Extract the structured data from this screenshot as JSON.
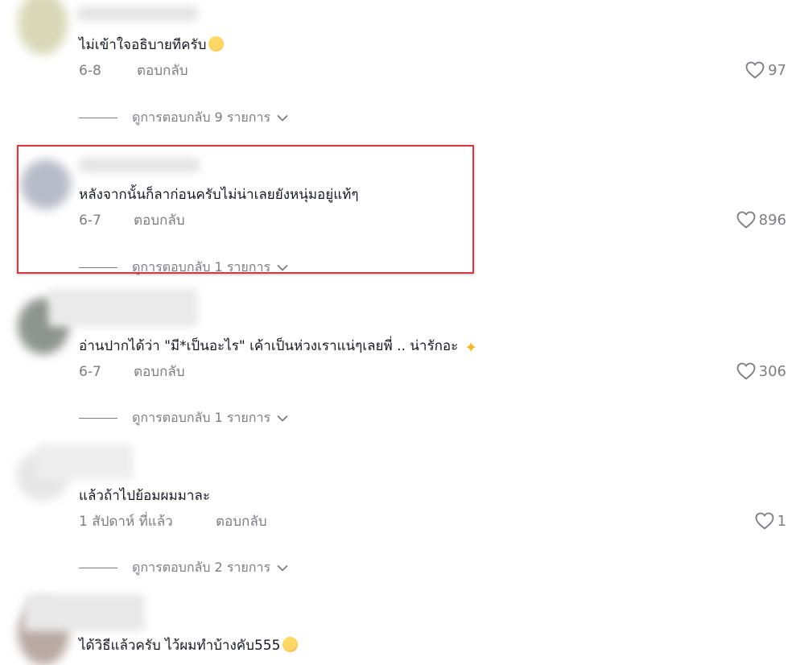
{
  "comments": [
    {
      "text": "ไม่เข้าใจอธิบายทีครับ",
      "date": "6-8",
      "reply_label": "ตอบกลับ",
      "likes": "97",
      "view_replies": "ดูการตอบกลับ 9 รายการ"
    },
    {
      "text": "หลังจากนั้นก็ลาก่อนครับไม่น่าเลยยังหนุ่มอยู่แท้ๆ",
      "date": "6-7",
      "reply_label": "ตอบกลับ",
      "likes": "896",
      "view_replies": "ดูการตอบกลับ 1 รายการ"
    },
    {
      "text": "อ่านปากได้ว่า \"มี*เป็นอะไร\" เค้าเป็นห่วงเราแน่ๆเลยพี่ .. น่ารักอะ",
      "date": "6-7",
      "reply_label": "ตอบกลับ",
      "likes": "306",
      "view_replies": "ดูการตอบกลับ 1 รายการ"
    },
    {
      "text": "แล้วถ้าไปย้อมผมมาละ",
      "date": "1 สัปดาห์ ที่แล้ว",
      "reply_label": "ตอบกลับ",
      "likes": "1",
      "view_replies": "ดูการตอบกลับ 2 รายการ"
    },
    {
      "text": "ได้วิธีแล้วครับ ไว้ผมทำบ้างคับ555",
      "date": "",
      "reply_label": "",
      "likes": "",
      "view_replies": ""
    }
  ],
  "icons": {
    "like": "heart-outline-icon",
    "expand": "chevron-down-icon",
    "emoji_1": "sweat-smile-emoji",
    "emoji_3": "sparkles-emoji",
    "emoji_5": "rolling-laughing-emoji"
  },
  "colors": {
    "text": "#161823",
    "muted": "#7c7d84",
    "highlight": "#d9363e"
  }
}
